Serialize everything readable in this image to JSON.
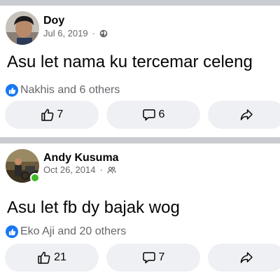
{
  "posts": [
    {
      "author": "Doy",
      "date": "Jul 6, 2019",
      "separator": "·",
      "audience_icon": "globe-icon",
      "text": "Asu let nama ku tercemar celeng",
      "reactions_text": "Nakhis and 6 others",
      "like_count": "7",
      "comment_count": "6",
      "online": false
    },
    {
      "author": "Andy Kusuma",
      "date": "Oct 26, 2014",
      "separator": "·",
      "audience_icon": "friends-icon",
      "text": "Asu let fb dy bajak wog",
      "reactions_text": "Eko Aji and 20 others",
      "like_count": "21",
      "comment_count": "7",
      "online": true
    }
  ],
  "colors": {
    "background": "#c9ccd1",
    "card": "#ffffff",
    "button": "#eef0f3",
    "like_blue": "#1877f2",
    "secondary_text": "#65676b",
    "online_green": "#42b72a"
  }
}
